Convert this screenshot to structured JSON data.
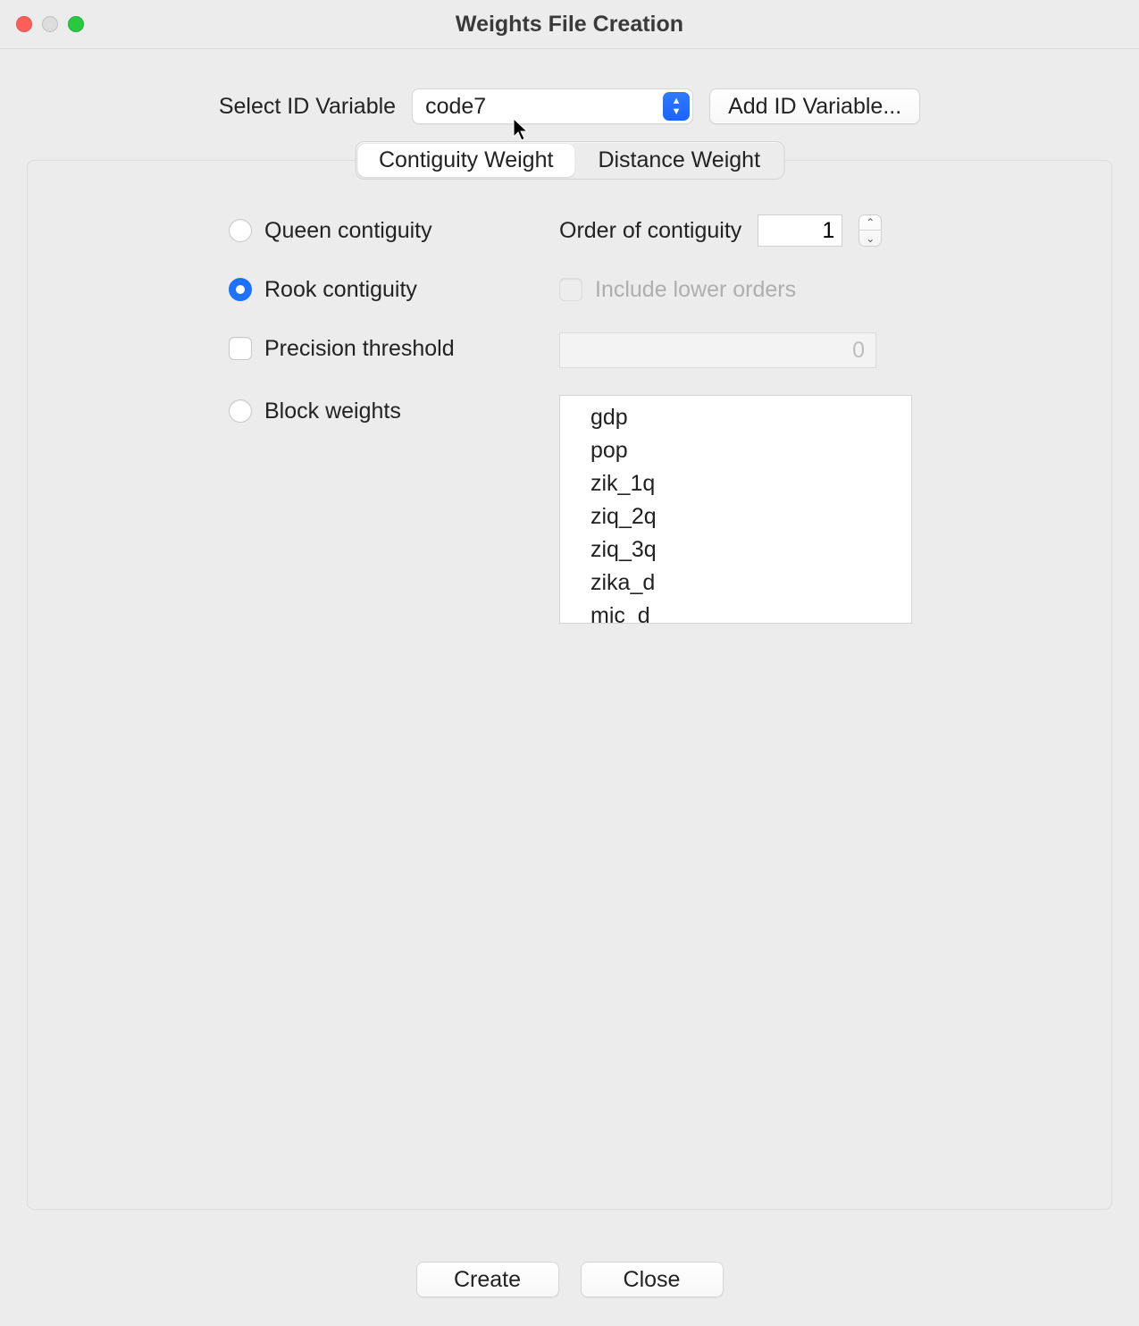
{
  "window": {
    "title": "Weights File Creation"
  },
  "id_row": {
    "label": "Select ID Variable",
    "selected": "code7",
    "add_button": "Add ID Variable..."
  },
  "tabs": {
    "contiguity": "Contiguity Weight",
    "distance": "Distance Weight",
    "active": "contiguity"
  },
  "options": {
    "queen": "Queen contiguity",
    "rook": "Rook contiguity",
    "precision": "Precision threshold",
    "block": "Block weights",
    "selected": "rook",
    "precision_checked": false
  },
  "order": {
    "label": "Order of contiguity",
    "value": "1"
  },
  "lower": {
    "label": "Include lower orders",
    "checked": false,
    "enabled": false
  },
  "precision_value": "0",
  "block_vars": [
    "gdp",
    "pop",
    "zik_1q",
    "ziq_2q",
    "ziq_3q",
    "zika_d",
    "mic_d"
  ],
  "buttons": {
    "create": "Create",
    "close": "Close"
  }
}
